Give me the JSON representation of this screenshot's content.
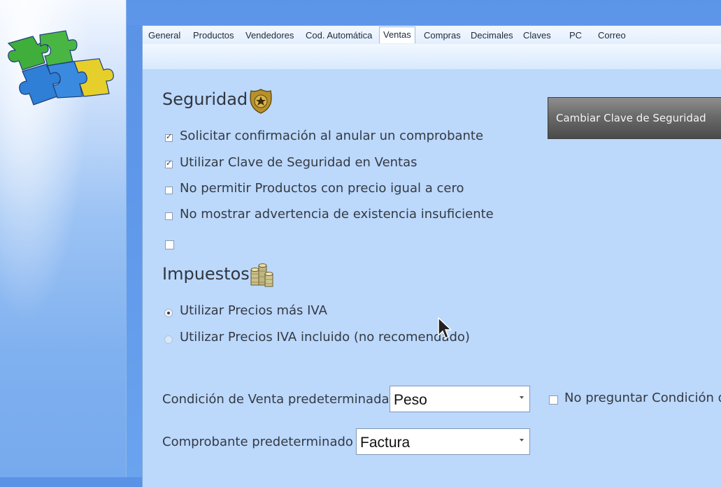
{
  "tabs": [
    {
      "label": "General",
      "active": false
    },
    {
      "label": "Productos",
      "active": false
    },
    {
      "label": "Vendedores",
      "active": false
    },
    {
      "label": "Cod. Automática",
      "active": false
    },
    {
      "label": "Ventas",
      "active": true
    },
    {
      "label": "Compras",
      "active": false
    },
    {
      "label": "Decimales",
      "active": false
    },
    {
      "label": "Claves",
      "active": false
    },
    {
      "label": "PC",
      "active": false
    },
    {
      "label": "Correo",
      "active": false
    }
  ],
  "seguridad": {
    "title": "Seguridad",
    "icon": "police-badge-icon",
    "options": [
      {
        "label": "Solicitar confirmación al anular un comprobante",
        "checked": true
      },
      {
        "label": "Utilizar Clave de Seguridad en Ventas",
        "checked": true
      },
      {
        "label": "No permitir Productos con precio igual a cero",
        "checked": false
      },
      {
        "label": "No mostrar advertencia de existencia insuficiente",
        "checked": false
      },
      {
        "label": "",
        "checked": false
      }
    ],
    "button_label": "Cambiar Clave de Seguridad"
  },
  "impuestos": {
    "title": "Impuestos",
    "icon": "coins-icon",
    "options": [
      {
        "label": "Utilizar Precios más IVA",
        "selected": true
      },
      {
        "label": "Utilizar Precios IVA incluido (no recomendado)",
        "selected": false
      }
    ]
  },
  "condicion": {
    "label": "Condición de Venta predeterminada",
    "value": "Peso",
    "no_preguntar_label": "No preguntar Condición de",
    "no_preguntar_checked": false
  },
  "comprobante": {
    "label": "Comprobante predeterminado",
    "value": "Factura"
  },
  "colors": {
    "panel_bg": "#bcd8fb",
    "button_bg": "#5a5a5a",
    "window_blue": "#5a93e6"
  }
}
